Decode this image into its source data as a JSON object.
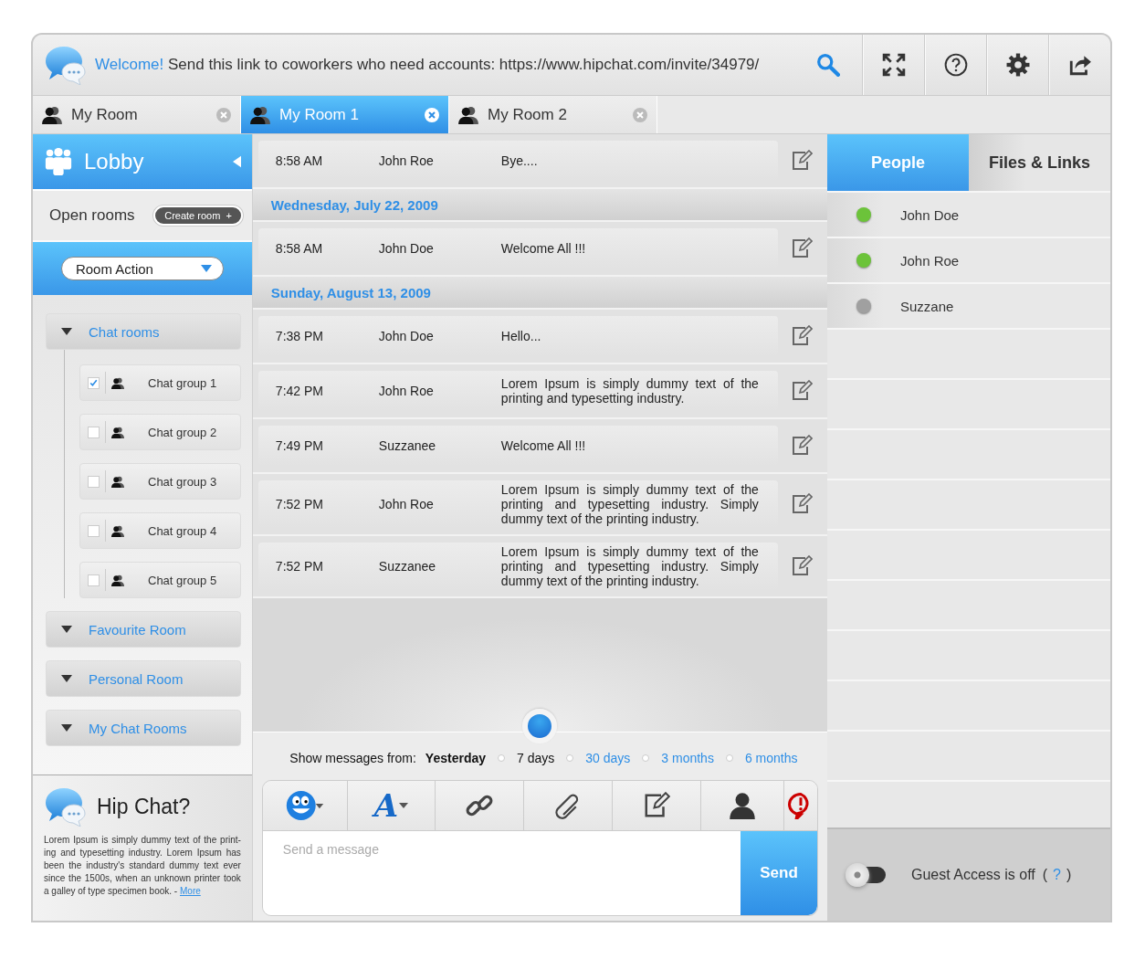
{
  "header": {
    "welcome": "Welcome!",
    "message": "Send this link to coworkers who need accounts: https://www.hipchat.com/invite/34979/"
  },
  "tabs": [
    {
      "label": "My Room",
      "selected": false
    },
    {
      "label": "My Room 1",
      "selected": true
    },
    {
      "label": "My Room 2",
      "selected": false
    }
  ],
  "sidebar": {
    "title": "Lobby",
    "open_rooms_label": "Open rooms",
    "create_button": "Create room",
    "create_plus": "+",
    "room_action": "Room Action",
    "groups": [
      {
        "label": "Chat rooms",
        "children": [
          {
            "label": "Chat group 1",
            "checked": true
          },
          {
            "label": "Chat group 2",
            "checked": false
          },
          {
            "label": "Chat group 3",
            "checked": false
          },
          {
            "label": "Chat group 4",
            "checked": false
          },
          {
            "label": "Chat group 5",
            "checked": false
          }
        ]
      },
      {
        "label": "Favourite Room"
      },
      {
        "label": "Personal Room"
      },
      {
        "label": "My Chat Rooms"
      }
    ]
  },
  "about": {
    "title": "Hip Chat?",
    "text": "Lorem Ipsum is simply dummy text of the print-ing and typesetting industry. Lorem Ipsum has been the industry's standard dummy text ever since the 1500s, when an unknown printer took a galley of type specimen book.  -",
    "link": "More"
  },
  "messages": [
    {
      "kind": "message",
      "time": "8:58 AM",
      "sender": "John Roe",
      "text": "Bye...."
    },
    {
      "kind": "date",
      "text": "Wednesday, July 22, 2009"
    },
    {
      "kind": "message",
      "time": "8:58 AM",
      "sender": "John Doe",
      "text": "Welcome All !!!"
    },
    {
      "kind": "date",
      "text": "Sunday, August 13, 2009"
    },
    {
      "kind": "message",
      "time": "7:38 PM",
      "sender": "John Doe",
      "text": "Hello..."
    },
    {
      "kind": "message",
      "time": "7:42 PM",
      "sender": "John Roe",
      "text": "Lorem Ipsum is simply dummy text of the printing and typesetting industry."
    },
    {
      "kind": "message",
      "time": "7:49 PM",
      "sender": "Suzzanee",
      "text": "Welcome All !!!"
    },
    {
      "kind": "message",
      "time": "7:52 PM",
      "sender": "John Roe",
      "text": "Lorem Ipsum is simply dummy text of the printing and typesetting industry. Simply dummy text of the printing industry."
    },
    {
      "kind": "message",
      "time": "7:52 PM",
      "sender": "Suzzanee",
      "text": "Lorem Ipsum is simply dummy text of the printing and typesetting industry. Simply dummy text of the printing industry."
    }
  ],
  "history": {
    "label": "Show messages from:",
    "current": "Yesterday",
    "options": [
      {
        "label": "7 days",
        "selected": true
      },
      {
        "label": "30 days",
        "selected": false
      },
      {
        "label": "3 months",
        "selected": false
      },
      {
        "label": "6 months",
        "selected": false
      }
    ]
  },
  "composer": {
    "font_glyph": "A",
    "placeholder": "Send a message",
    "send": "Send"
  },
  "people_tabs": [
    {
      "label": "People",
      "selected": true
    },
    {
      "label": "Files & Links",
      "selected": false
    }
  ],
  "people": [
    {
      "name": "John Doe",
      "color": "#6cc33a"
    },
    {
      "name": "John Roe",
      "color": "#6cc33a"
    },
    {
      "name": "Suzzane",
      "color": "#a0a0a0"
    }
  ],
  "guest": {
    "on": false,
    "label": "Guest Access is off",
    "help_open": "(",
    "help": "?",
    "help_close": ")"
  }
}
